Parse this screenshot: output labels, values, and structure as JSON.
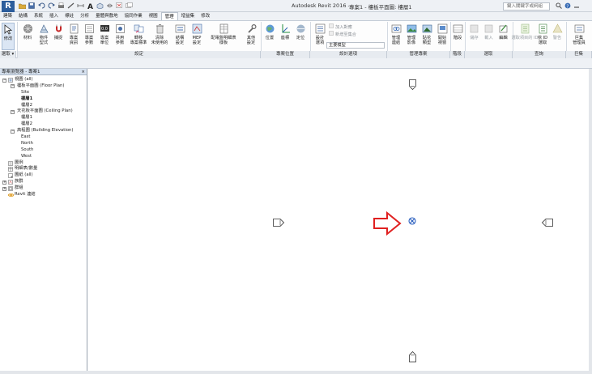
{
  "titlebar": {
    "app_name": "Autodesk Revit 2016 -",
    "document": "專案1 - 樓板平面圖: 樓層1",
    "search_placeholder": "鍵入關鍵字或詞組"
  },
  "tabs": [
    "建築",
    "結構",
    "系統",
    "插入",
    "標註",
    "分析",
    "量體與敷地",
    "協同作業",
    "視圖",
    "管理",
    "增益集",
    "修改"
  ],
  "active_tab": "管理",
  "ribbon": {
    "buttons": [
      "修改",
      "材料",
      "物件\n型式",
      "捕捉",
      "專案\n資訊",
      "專案\n參數",
      "共用\n參數",
      "專案\n單位",
      "轉移\n專案標準",
      "清除\n未使用的",
      "結構\n設定",
      "MEP\n設定",
      "配電盤明細表\n樣板",
      "其他\n設定",
      "位置",
      "座標",
      "定位",
      "設計\n選項",
      "管理\n連結",
      "管理\n影像",
      "貼花\n類型",
      "開始\n視窗",
      "階段",
      "選取",
      "載入",
      "編輯",
      "依 ID\n選取",
      "警告",
      "巨集\n管理員"
    ],
    "dim_buttons": [
      "儲存",
      "載入",
      "選取項目的 ID",
      "警告"
    ],
    "small_buttons": [
      "加入對應",
      "新增至集合"
    ],
    "design_option_value": "主要模型",
    "panels": [
      "選取",
      "設定",
      "專案位置",
      "設計選項",
      "管理專案",
      "階段",
      "選取",
      "查詢",
      "巨集"
    ]
  },
  "modify_label": "選取 ▾",
  "browser": {
    "title": "專案瀏覽器 - 專案1",
    "close": "×",
    "tree": [
      {
        "label": "視圖 (all)",
        "level": 0,
        "toggle": "−",
        "icon": "views"
      },
      {
        "label": "樓板平面圖 (Floor Plan)",
        "level": 1,
        "toggle": "−"
      },
      {
        "label": "Site",
        "level": 2
      },
      {
        "label": "樓層1",
        "level": 2,
        "bold": true
      },
      {
        "label": "樓層2",
        "level": 2
      },
      {
        "label": "天花板平面圖 (Ceiling Plan)",
        "level": 1,
        "toggle": "−"
      },
      {
        "label": "樓層1",
        "level": 2
      },
      {
        "label": "樓層2",
        "level": 2
      },
      {
        "label": "高程圖 (Building Elevation)",
        "level": 1,
        "toggle": "−"
      },
      {
        "label": "East",
        "level": 2
      },
      {
        "label": "North",
        "level": 2
      },
      {
        "label": "South",
        "level": 2
      },
      {
        "label": "West",
        "level": 2
      },
      {
        "label": "圖例",
        "level": 0,
        "icon": "legend"
      },
      {
        "label": "明細表/數量",
        "level": 0,
        "icon": "schedule"
      },
      {
        "label": "圖紙 (all)",
        "level": 0,
        "icon": "sheet"
      },
      {
        "label": "族群",
        "level": 0,
        "toggle": "+",
        "icon": "family"
      },
      {
        "label": "群組",
        "level": 0,
        "toggle": "+",
        "icon": "group"
      },
      {
        "label": "Revit 連結",
        "level": 0,
        "icon": "link"
      }
    ]
  },
  "colors": {
    "arrow": "#e02020",
    "marker": "#2a5fbf",
    "tab_active_border": "#b8c1cc",
    "browser_header": "#d7e2f0"
  },
  "icons": [
    "revit-app-icon",
    "open-icon",
    "save-icon",
    "undo-icon",
    "redo-icon",
    "print-icon",
    "measure-icon",
    "text-icon",
    "3d-view-icon",
    "section-icon",
    "close-inactive-icon",
    "switch-windows-icon",
    "search-icon",
    "help-icon"
  ]
}
